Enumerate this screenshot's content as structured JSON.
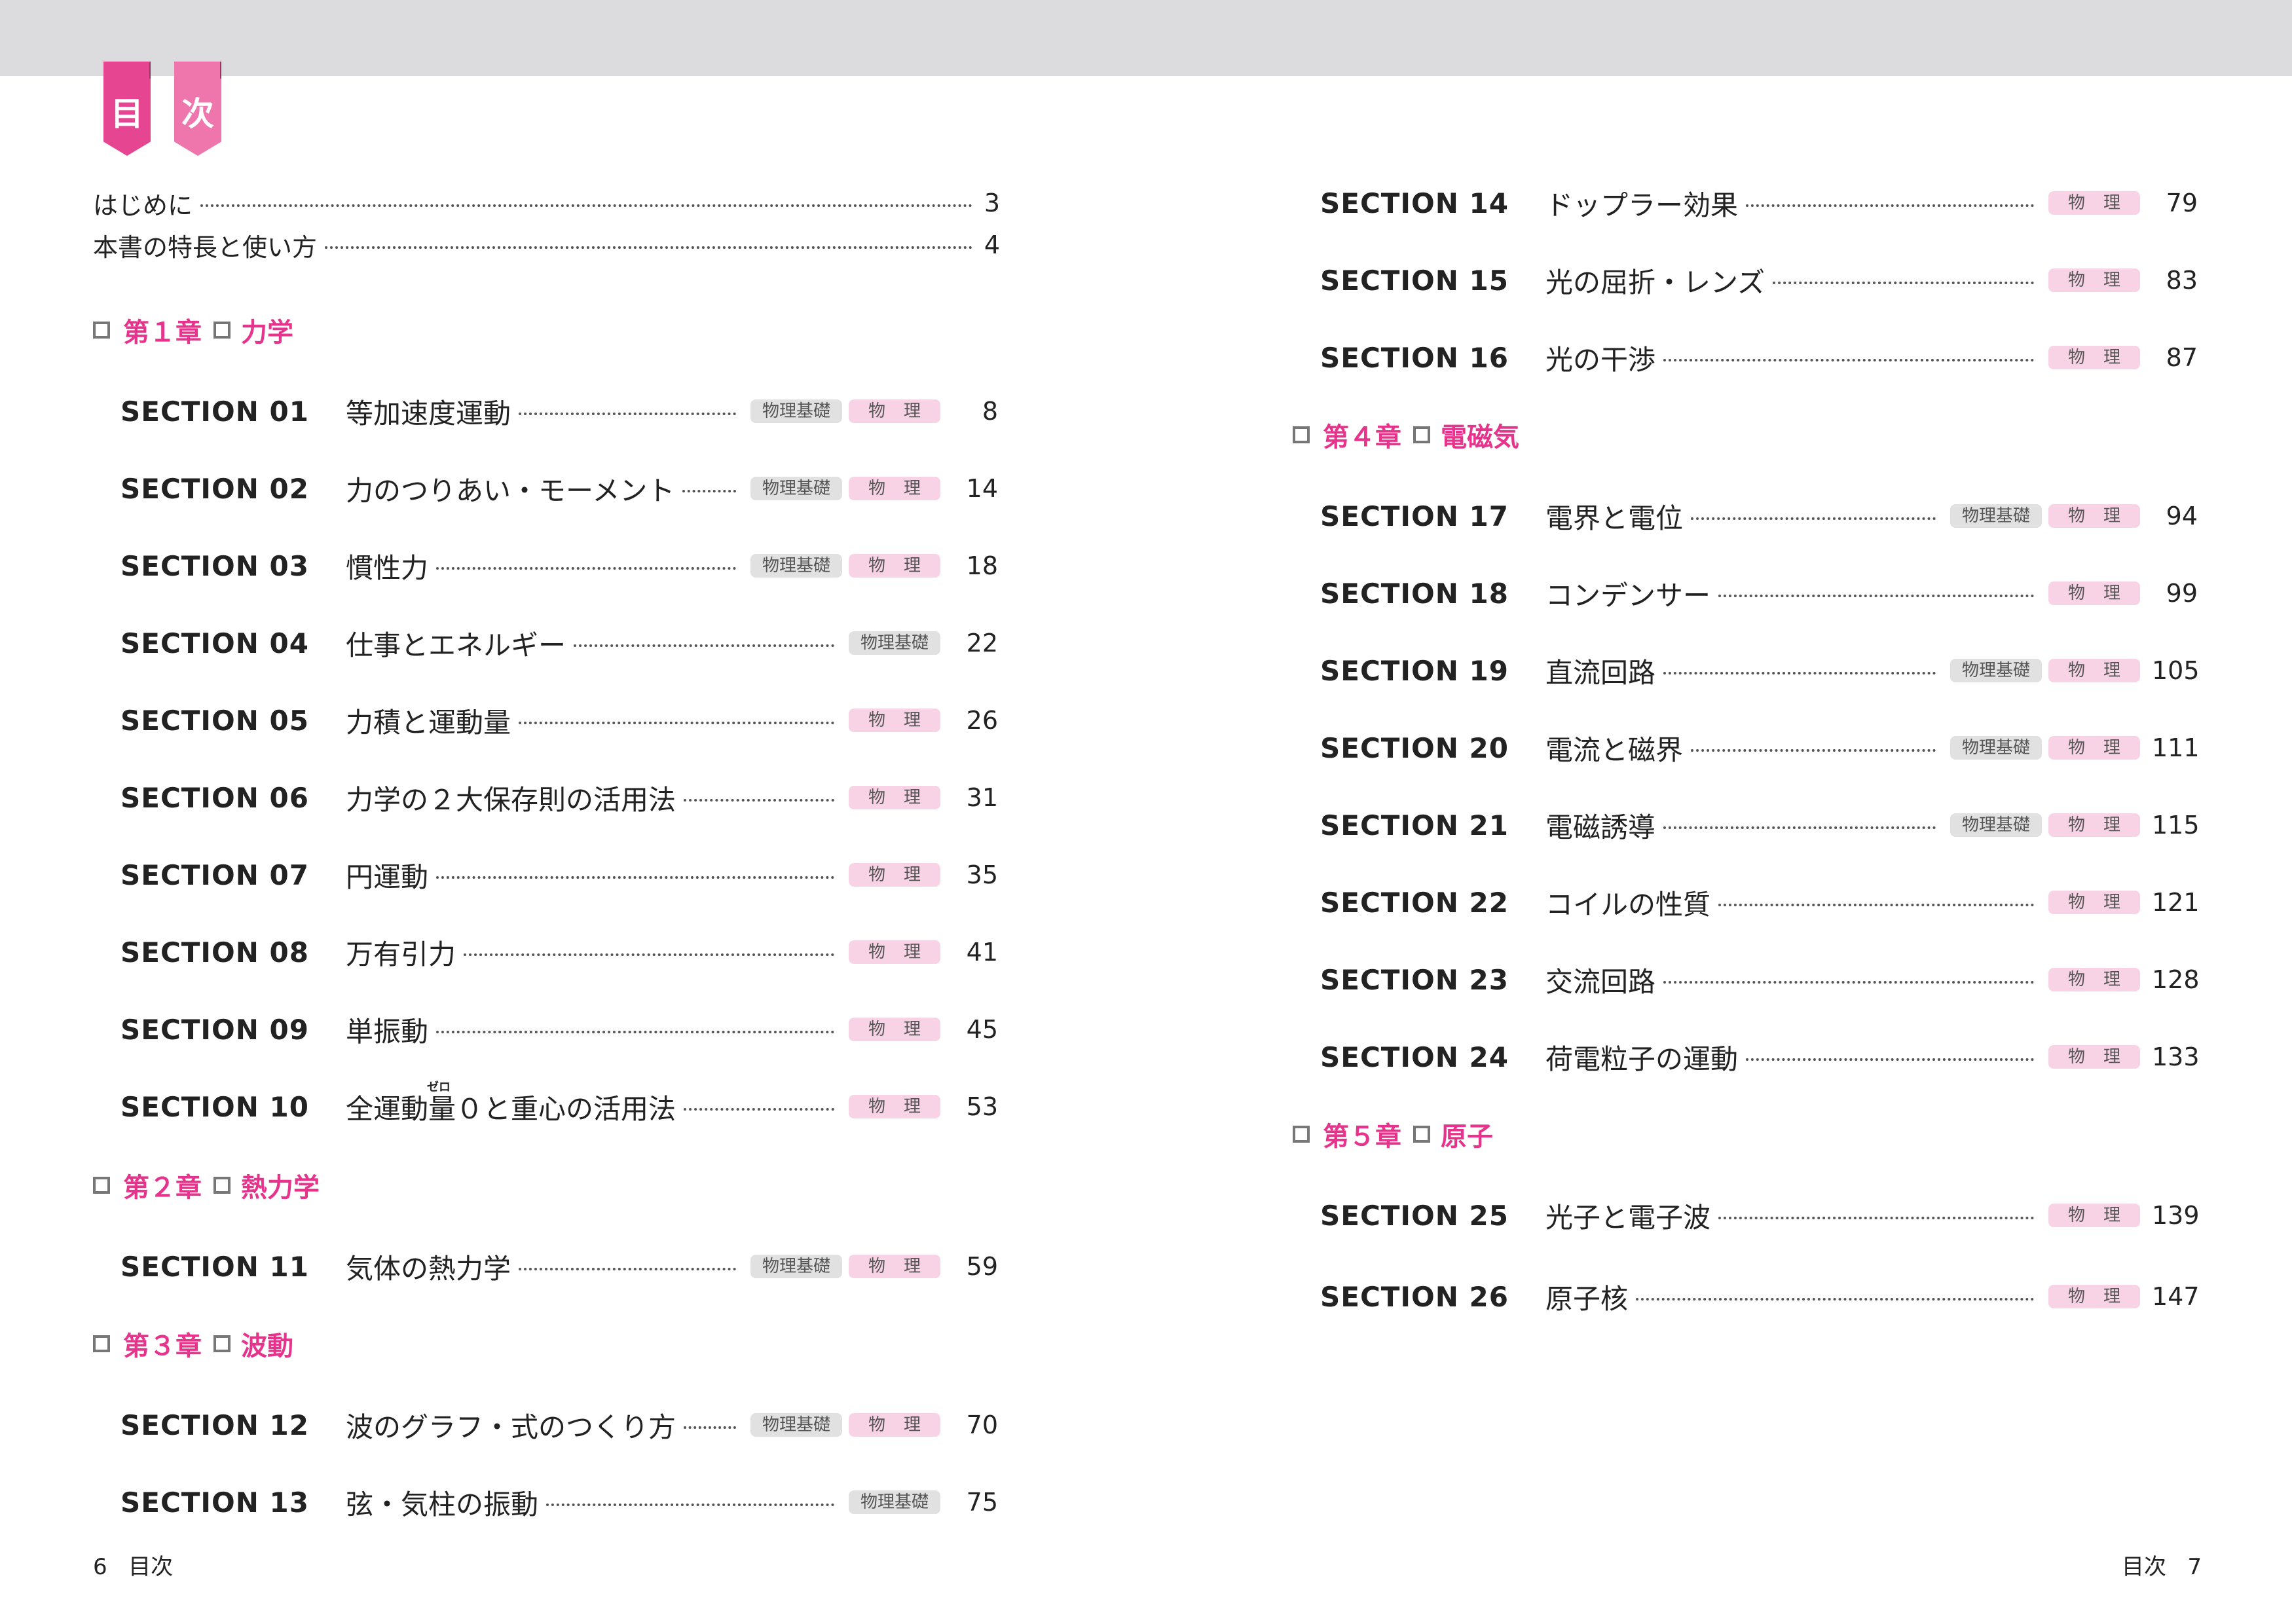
{
  "header": {
    "ribbon_1": "目",
    "ribbon_2": "次"
  },
  "intro": [
    {
      "title": "はじめに",
      "page": "3"
    },
    {
      "title": "本書の特長と使い方",
      "page": "4"
    }
  ],
  "chapters": [
    {
      "label": "第１章",
      "name": "力学"
    },
    {
      "label": "第２章",
      "name": "熱力学"
    },
    {
      "label": "第３章",
      "name": "波動"
    },
    {
      "label": "第４章",
      "name": "電磁気"
    },
    {
      "label": "第５章",
      "name": "原子"
    }
  ],
  "tags": {
    "basic": "物理基礎",
    "advanced": "物理"
  },
  "sections": [
    {
      "label": "SECTION 01",
      "title": "等加速度運動",
      "page": "8"
    },
    {
      "label": "SECTION 02",
      "title": "力のつりあい・モーメント",
      "page": "14"
    },
    {
      "label": "SECTION 03",
      "title": "慣性力",
      "page": "18"
    },
    {
      "label": "SECTION 04",
      "title": "仕事とエネルギー",
      "page": "22"
    },
    {
      "label": "SECTION 05",
      "title": "力積と運動量",
      "page": "26"
    },
    {
      "label": "SECTION 06",
      "title": "力学の２大保存則の活用法",
      "page": "31"
    },
    {
      "label": "SECTION 07",
      "title": "円運動",
      "page": "35"
    },
    {
      "label": "SECTION 08",
      "title": "万有引力",
      "page": "41"
    },
    {
      "label": "SECTION 09",
      "title": "単振動",
      "page": "45"
    },
    {
      "label": "SECTION 10",
      "title": "全運動量０と重心の活用法",
      "ruby": "ゼロ",
      "page": "53"
    },
    {
      "label": "SECTION 11",
      "title": "気体の熱力学",
      "page": "59"
    },
    {
      "label": "SECTION 12",
      "title": "波のグラフ・式のつくり方",
      "page": "70"
    },
    {
      "label": "SECTION 13",
      "title": "弦・気柱の振動",
      "page": "75"
    },
    {
      "label": "SECTION 14",
      "title": "ドップラー効果",
      "page": "79"
    },
    {
      "label": "SECTION 15",
      "title": "光の屈折・レンズ",
      "page": "83"
    },
    {
      "label": "SECTION 16",
      "title": "光の干渉",
      "page": "87"
    },
    {
      "label": "SECTION 17",
      "title": "電界と電位",
      "page": "94"
    },
    {
      "label": "SECTION 18",
      "title": "コンデンサー",
      "page": "99"
    },
    {
      "label": "SECTION 19",
      "title": "直流回路",
      "page": "105"
    },
    {
      "label": "SECTION 20",
      "title": "電流と磁界",
      "page": "111"
    },
    {
      "label": "SECTION 21",
      "title": "電磁誘導",
      "page": "115"
    },
    {
      "label": "SECTION 22",
      "title": "コイルの性質",
      "page": "121"
    },
    {
      "label": "SECTION 23",
      "title": "交流回路",
      "page": "128"
    },
    {
      "label": "SECTION 24",
      "title": "荷電粒子の運動",
      "page": "133"
    },
    {
      "label": "SECTION 25",
      "title": "光子と電子波",
      "page": "139"
    },
    {
      "label": "SECTION 26",
      "title": "原子核",
      "page": "147"
    }
  ],
  "footer": {
    "left_page": "6",
    "left_label": "目次",
    "right_label": "目次",
    "right_page": "7"
  },
  "colors": {
    "accent": "#e6348c",
    "ribbon_dark": "#e64691",
    "ribbon_light": "#ee76ac",
    "topbar": "#dcdcdf"
  }
}
